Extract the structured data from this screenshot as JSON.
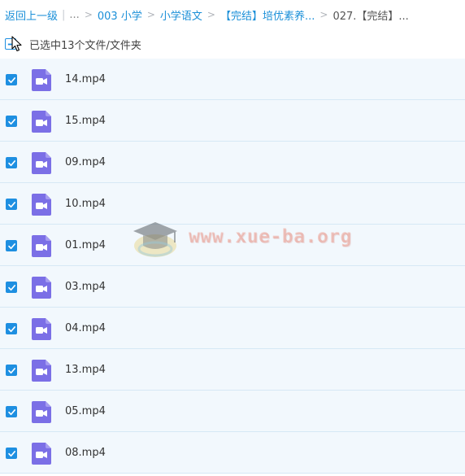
{
  "breadcrumb": {
    "back_label": "返回上一级",
    "ellipsis": "...",
    "separator": ">",
    "items": [
      "003 小学",
      "小学语文",
      "【完结】培优素养...",
      "027.【完结】..."
    ]
  },
  "selection": {
    "label": "已选中13个文件/文件夹"
  },
  "files": [
    {
      "name": "14.mp4"
    },
    {
      "name": "15.mp4"
    },
    {
      "name": "09.mp4"
    },
    {
      "name": "10.mp4"
    },
    {
      "name": "01.mp4"
    },
    {
      "name": "03.mp4"
    },
    {
      "name": "04.mp4"
    },
    {
      "name": "13.mp4"
    },
    {
      "name": "05.mp4"
    },
    {
      "name": "08.mp4"
    }
  ],
  "watermark": {
    "text": "www.xue-ba.org",
    "icon": "graduation-cap-icon"
  },
  "colors": {
    "link": "#1a8fd8",
    "checkbox": "#1e8fe1",
    "video_icon": "#7b6fe6",
    "row_bg": "#f2f8fd",
    "row_border": "#d6e8f5"
  }
}
